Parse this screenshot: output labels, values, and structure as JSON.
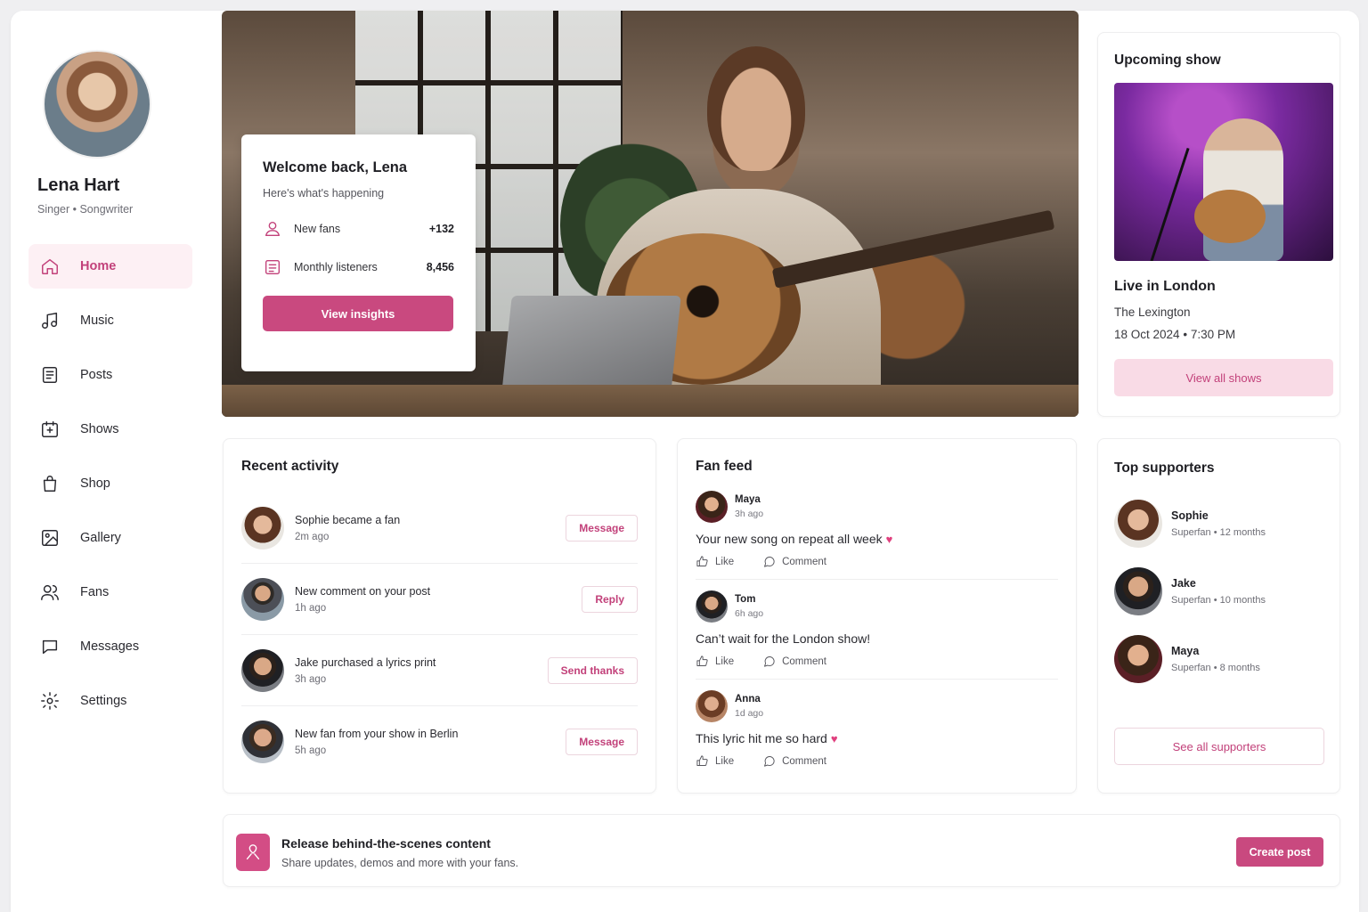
{
  "profile": {
    "name": "Lena Hart",
    "role": "Singer • Songwriter"
  },
  "nav": {
    "items": [
      {
        "label": "Home",
        "icon": "home-icon",
        "active": true
      },
      {
        "label": "Music",
        "icon": "music-note-icon"
      },
      {
        "label": "Posts",
        "icon": "document-icon"
      },
      {
        "label": "Shows",
        "icon": "calendar-icon"
      },
      {
        "label": "Shop",
        "icon": "shopping-bag-icon"
      },
      {
        "label": "Gallery",
        "icon": "image-icon"
      },
      {
        "label": "Fans",
        "icon": "users-icon"
      },
      {
        "label": "Messages",
        "icon": "chat-bubble-icon"
      },
      {
        "label": "Settings",
        "icon": "gear-icon"
      }
    ]
  },
  "welcome": {
    "title": "Welcome back, Lena",
    "subtitle": "Here's what's happening",
    "stats": [
      {
        "label": "New fans",
        "value": "+132",
        "icon": "fans-icon"
      },
      {
        "label": "Monthly listeners",
        "value": "8,456",
        "icon": "listeners-icon"
      }
    ],
    "button": "View insights"
  },
  "upcoming_show": {
    "heading": "Upcoming show",
    "title": "Live in London",
    "venue": "The Lexington",
    "date": "18 Oct 2024",
    "time": "7:30 PM",
    "button": "View all shows"
  },
  "recent_activity": {
    "heading": "Recent activity",
    "items": [
      {
        "text": "Sophie became a fan",
        "time": "2m ago",
        "action": "Message"
      },
      {
        "text": "New comment on your post",
        "time": "1h ago",
        "action": "Reply"
      },
      {
        "text": "Jake purchased a lyrics print",
        "time": "3h ago",
        "action": "Send thanks"
      },
      {
        "text": "New fan from your show in Berlin",
        "time": "5h ago",
        "action": "Message"
      }
    ]
  },
  "fan_feed": {
    "heading": "Fan feed",
    "like_label": "Like",
    "comment_label": "Comment",
    "posts": [
      {
        "name": "Maya",
        "time": "3h ago",
        "text": "Your new song on repeat all week",
        "heart": "♥"
      },
      {
        "name": "Tom",
        "time": "6h ago",
        "text": "Can’t wait for the London show!",
        "heart": ""
      },
      {
        "name": "Anna",
        "time": "1d ago",
        "text": "This lyric hit me so hard",
        "heart": "♥"
      }
    ]
  },
  "top_supporters": {
    "heading": "Top supporters",
    "items": [
      {
        "name": "Sophie",
        "detail": "Superfan • 12 months"
      },
      {
        "name": "Jake",
        "detail": "Superfan • 10 months"
      },
      {
        "name": "Maya",
        "detail": "Superfan • 8 months"
      }
    ],
    "button": "See all supporters"
  },
  "banner": {
    "title": "Release behind-the-scenes content",
    "subtitle": "Share updates, demos and more with your fans.",
    "button": "Create post"
  },
  "colors": {
    "accent": "#c9497f",
    "accent_soft": "#f9dbe6",
    "active_nav_bg": "#fdf0f4"
  }
}
